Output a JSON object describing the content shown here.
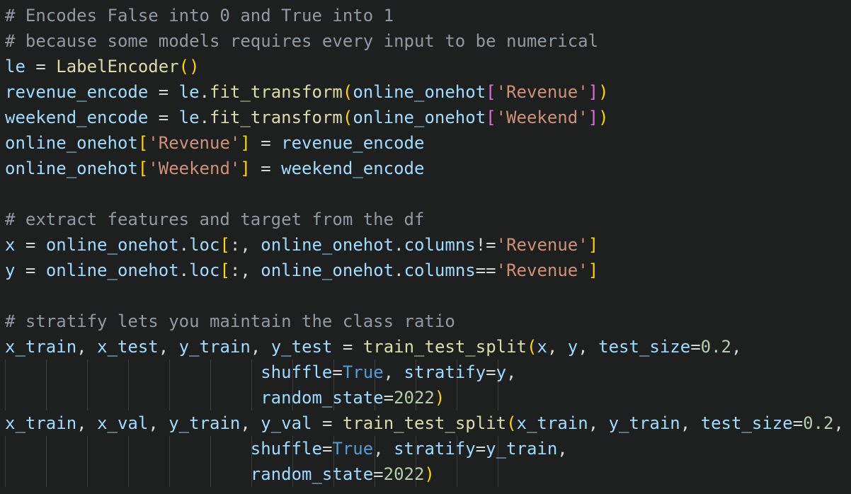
{
  "editor": {
    "language": "python",
    "lines": [
      {
        "segments": [
          {
            "t": "comment",
            "v": "# Encodes False into 0 and True into 1"
          }
        ]
      },
      {
        "segments": [
          {
            "t": "comment",
            "v": "# because some models requires every input to be numerical"
          }
        ]
      },
      {
        "segments": [
          {
            "t": "var",
            "v": "le"
          },
          {
            "t": "op",
            "v": " = "
          },
          {
            "t": "fn",
            "v": "LabelEncoder"
          },
          {
            "t": "bracket-yellow",
            "v": "()"
          }
        ]
      },
      {
        "segments": [
          {
            "t": "var",
            "v": "revenue_encode"
          },
          {
            "t": "op",
            "v": " = "
          },
          {
            "t": "var",
            "v": "le"
          },
          {
            "t": "punct",
            "v": "."
          },
          {
            "t": "fn",
            "v": "fit_transform"
          },
          {
            "t": "bracket-yellow",
            "v": "("
          },
          {
            "t": "var",
            "v": "online_onehot"
          },
          {
            "t": "bracket-purple",
            "v": "["
          },
          {
            "t": "str",
            "v": "'Revenue'"
          },
          {
            "t": "bracket-purple",
            "v": "]"
          },
          {
            "t": "bracket-yellow",
            "v": ")"
          }
        ]
      },
      {
        "segments": [
          {
            "t": "var",
            "v": "weekend_encode"
          },
          {
            "t": "op",
            "v": " = "
          },
          {
            "t": "var",
            "v": "le"
          },
          {
            "t": "punct",
            "v": "."
          },
          {
            "t": "fn",
            "v": "fit_transform"
          },
          {
            "t": "bracket-yellow",
            "v": "("
          },
          {
            "t": "var",
            "v": "online_onehot"
          },
          {
            "t": "bracket-purple",
            "v": "["
          },
          {
            "t": "str",
            "v": "'Weekend'"
          },
          {
            "t": "bracket-purple",
            "v": "]"
          },
          {
            "t": "bracket-yellow",
            "v": ")"
          }
        ]
      },
      {
        "segments": [
          {
            "t": "var",
            "v": "online_onehot"
          },
          {
            "t": "bracket-yellow",
            "v": "["
          },
          {
            "t": "str",
            "v": "'Revenue'"
          },
          {
            "t": "bracket-yellow",
            "v": "]"
          },
          {
            "t": "op",
            "v": " = "
          },
          {
            "t": "var",
            "v": "revenue_encode"
          }
        ]
      },
      {
        "segments": [
          {
            "t": "var",
            "v": "online_onehot"
          },
          {
            "t": "bracket-yellow",
            "v": "["
          },
          {
            "t": "str",
            "v": "'Weekend'"
          },
          {
            "t": "bracket-yellow",
            "v": "]"
          },
          {
            "t": "op",
            "v": " = "
          },
          {
            "t": "var",
            "v": "weekend_encode"
          }
        ]
      },
      {
        "segments": []
      },
      {
        "segments": [
          {
            "t": "comment",
            "v": "# extract features and target from the df"
          }
        ]
      },
      {
        "segments": [
          {
            "t": "var",
            "v": "x"
          },
          {
            "t": "op",
            "v": " = "
          },
          {
            "t": "var",
            "v": "online_onehot"
          },
          {
            "t": "punct",
            "v": "."
          },
          {
            "t": "var",
            "v": "loc"
          },
          {
            "t": "bracket-yellow",
            "v": "["
          },
          {
            "t": "punct",
            "v": ":, "
          },
          {
            "t": "var",
            "v": "online_onehot"
          },
          {
            "t": "punct",
            "v": "."
          },
          {
            "t": "var",
            "v": "columns"
          },
          {
            "t": "op",
            "v": "!="
          },
          {
            "t": "str",
            "v": "'Revenue'"
          },
          {
            "t": "bracket-yellow",
            "v": "]"
          }
        ]
      },
      {
        "segments": [
          {
            "t": "var",
            "v": "y"
          },
          {
            "t": "op",
            "v": " = "
          },
          {
            "t": "var",
            "v": "online_onehot"
          },
          {
            "t": "punct",
            "v": "."
          },
          {
            "t": "var",
            "v": "loc"
          },
          {
            "t": "bracket-yellow",
            "v": "["
          },
          {
            "t": "punct",
            "v": ":, "
          },
          {
            "t": "var",
            "v": "online_onehot"
          },
          {
            "t": "punct",
            "v": "."
          },
          {
            "t": "var",
            "v": "columns"
          },
          {
            "t": "op",
            "v": "=="
          },
          {
            "t": "str",
            "v": "'Revenue'"
          },
          {
            "t": "bracket-yellow",
            "v": "]"
          }
        ]
      },
      {
        "segments": []
      },
      {
        "segments": [
          {
            "t": "comment",
            "v": "# stratify lets you maintain the class ratio"
          }
        ]
      },
      {
        "segments": [
          {
            "t": "var",
            "v": "x_train"
          },
          {
            "t": "punct",
            "v": ", "
          },
          {
            "t": "var",
            "v": "x_test"
          },
          {
            "t": "punct",
            "v": ", "
          },
          {
            "t": "var",
            "v": "y_train"
          },
          {
            "t": "punct",
            "v": ", "
          },
          {
            "t": "var",
            "v": "y_test"
          },
          {
            "t": "op",
            "v": " = "
          },
          {
            "t": "fn",
            "v": "train_test_split"
          },
          {
            "t": "bracket-yellow",
            "v": "("
          },
          {
            "t": "var",
            "v": "x"
          },
          {
            "t": "punct",
            "v": ", "
          },
          {
            "t": "var",
            "v": "y"
          },
          {
            "t": "punct",
            "v": ", "
          },
          {
            "t": "param",
            "v": "test_size"
          },
          {
            "t": "op",
            "v": "="
          },
          {
            "t": "num",
            "v": "0.2"
          },
          {
            "t": "punct",
            "v": ","
          }
        ]
      },
      {
        "guides": true,
        "segments": [
          {
            "t": "op",
            "v": "                         "
          },
          {
            "t": "param",
            "v": "shuffle"
          },
          {
            "t": "op",
            "v": "="
          },
          {
            "t": "kw",
            "v": "True"
          },
          {
            "t": "punct",
            "v": ", "
          },
          {
            "t": "param",
            "v": "stratify"
          },
          {
            "t": "op",
            "v": "="
          },
          {
            "t": "var",
            "v": "y"
          },
          {
            "t": "punct",
            "v": ","
          }
        ]
      },
      {
        "guides": true,
        "segments": [
          {
            "t": "op",
            "v": "                         "
          },
          {
            "t": "param",
            "v": "random_state"
          },
          {
            "t": "op",
            "v": "="
          },
          {
            "t": "num",
            "v": "2022"
          },
          {
            "t": "bracket-yellow",
            "v": ")"
          }
        ]
      },
      {
        "segments": [
          {
            "t": "var",
            "v": "x_train"
          },
          {
            "t": "punct",
            "v": ", "
          },
          {
            "t": "var",
            "v": "x_val"
          },
          {
            "t": "punct",
            "v": ", "
          },
          {
            "t": "var",
            "v": "y_train"
          },
          {
            "t": "punct",
            "v": ", "
          },
          {
            "t": "var",
            "v": "y_val"
          },
          {
            "t": "op",
            "v": " = "
          },
          {
            "t": "fn",
            "v": "train_test_split"
          },
          {
            "t": "bracket-yellow",
            "v": "("
          },
          {
            "t": "var",
            "v": "x_train"
          },
          {
            "t": "punct",
            "v": ", "
          },
          {
            "t": "var",
            "v": "y_train"
          },
          {
            "t": "punct",
            "v": ", "
          },
          {
            "t": "param",
            "v": "test_size"
          },
          {
            "t": "op",
            "v": "="
          },
          {
            "t": "num",
            "v": "0.2"
          },
          {
            "t": "punct",
            "v": ","
          }
        ]
      },
      {
        "guides": true,
        "segments": [
          {
            "t": "op",
            "v": "                        "
          },
          {
            "t": "param",
            "v": "shuffle"
          },
          {
            "t": "op",
            "v": "="
          },
          {
            "t": "kw",
            "v": "True"
          },
          {
            "t": "punct",
            "v": ", "
          },
          {
            "t": "param",
            "v": "stratify"
          },
          {
            "t": "op",
            "v": "="
          },
          {
            "t": "var",
            "v": "y_train"
          },
          {
            "t": "punct",
            "v": ","
          }
        ]
      },
      {
        "guides": true,
        "segments": [
          {
            "t": "op",
            "v": "                        "
          },
          {
            "t": "param",
            "v": "random_state"
          },
          {
            "t": "op",
            "v": "="
          },
          {
            "t": "num",
            "v": "2022"
          },
          {
            "t": "bracket-yellow",
            "v": ")"
          }
        ]
      }
    ]
  },
  "colors": {
    "background": "#1e1f1f",
    "comment": "#8f9aa3",
    "variable": "#9fdcfe",
    "function": "#dcdcaa",
    "string": "#ce9178",
    "keyword": "#569cd6",
    "number": "#b5cea8",
    "bracket": "#ffd700"
  }
}
